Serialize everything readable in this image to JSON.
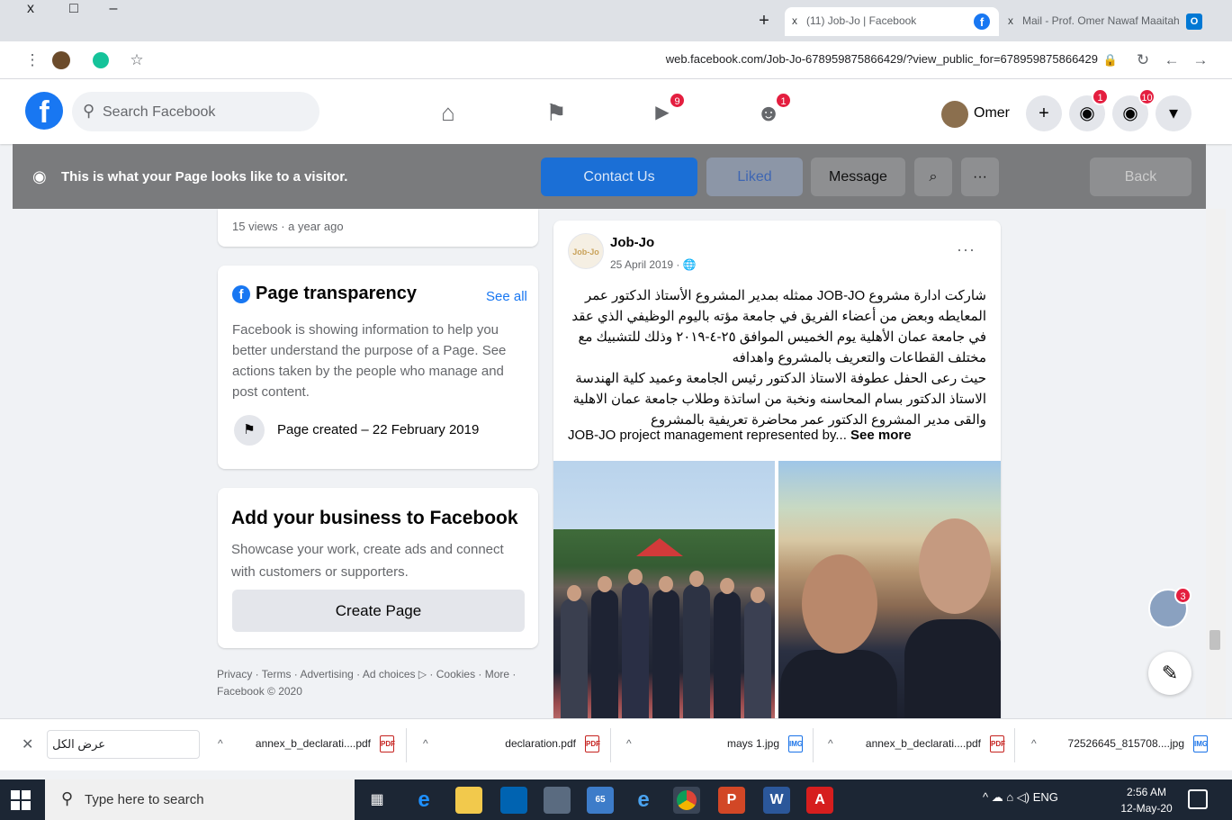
{
  "browser": {
    "window_controls": [
      "x",
      "□",
      "–"
    ],
    "new_tab": "+",
    "tabs": [
      {
        "title": "(11) Job-Jo | Facebook",
        "close": "x",
        "favicon": "f"
      },
      {
        "title": "Mail - Prof. Omer Nawaf Maaitah",
        "close": "x",
        "favicon": "O"
      }
    ],
    "url": "web.facebook.com/Job-Jo-678959875866429/?view_public_for=678959875866429",
    "nav_icons": {
      "menu": "⋮",
      "star": "☆",
      "lock": "🔒",
      "reload": "↻",
      "back": "←",
      "forward": "→"
    }
  },
  "fb_header": {
    "logo": "f",
    "search_placeholder": "Search Facebook",
    "nav": [
      {
        "name": "home-icon",
        "glyph": "⌂",
        "badge": ""
      },
      {
        "name": "flag-icon",
        "glyph": "⚑",
        "badge": ""
      },
      {
        "name": "watch-icon",
        "glyph": "▶",
        "badge": "9"
      },
      {
        "name": "groups-icon",
        "glyph": "☻",
        "badge": "1"
      }
    ],
    "profile_name": "Omer",
    "buttons": {
      "create": "+",
      "messenger_badge": "1",
      "notifications_badge": "10",
      "menu": "▾"
    }
  },
  "visitor_bar": {
    "text": "This is what your Page looks like to a visitor.",
    "contact": "Contact Us",
    "liked": "Liked",
    "message": "Message",
    "search": "⌕",
    "more": "···",
    "back": "Back"
  },
  "left": {
    "video_meta": "15 views · a year ago",
    "transparency": {
      "title": "Page transparency",
      "see_all": "See all",
      "description": "Facebook is showing information to help you better understand the purpose of a Page. See actions taken by the people who manage and post content.",
      "created": "Page created – 22 February 2019"
    },
    "business": {
      "title": "Add your business to Facebook",
      "description": "Showcase your work, create ads and connect with customers or supporters.",
      "button": "Create Page"
    },
    "footer": "Privacy · Terms · Advertising · Ad choices ▷ · Cookies · More · Facebook © 2020"
  },
  "post": {
    "avatar_text": "Job-Jo",
    "author": "Job-Jo",
    "date": "25 April 2019 · 🌐",
    "more": "···",
    "arabic": "شاركت ادارة مشروع JOB-JO ممثله بمدير المشروع الأستاذ الدكتور عمر المعايطه وبعض من أعضاء الفريق في جامعة مؤته باليوم الوظيفي الذي عقد في جامعة عمان الأهلية يوم الخميس الموافق ٢٥-٤-٢٠١٩ وذلك للتشبيك مع مختلف القطاعات والتعريف بالمشروع واهدافه\nحيث رعى الحفل عطوفة الاستاذ الدكتور رئيس الجامعة وعميد كلية الهندسة الاستاذ الدكتور بسام المحاسنه ونخبة من اساتذة وطلاب جامعة عمان الاهلية\nوالقى مدير المشروع الدكتور عمر محاضرة تعريفية بالمشروع",
    "english": "JOB-JO project management represented by...",
    "see_more": "See more"
  },
  "floating": {
    "chat_badge": "3",
    "compose": "✎"
  },
  "downloads": {
    "close": "✕",
    "show_all": "عرض الكل",
    "items": [
      {
        "name": "annex_b_declarati....pdf",
        "type": "PDF"
      },
      {
        "name": "declaration.pdf",
        "type": "PDF"
      },
      {
        "name": "mays 1.jpg",
        "type": "IMG"
      },
      {
        "name": "annex_b_declarati....pdf",
        "type": "PDF"
      },
      {
        "name": "72526645_815708....jpg",
        "type": "IMG"
      }
    ]
  },
  "taskbar": {
    "search": "Type here to search",
    "tray": "^ ☁ ⌂ ◁) ENG",
    "time": "2:56 AM",
    "date": "12-May-20"
  },
  "colors": {
    "facebook_blue": "#1877f2",
    "badge_red": "#e41e3f",
    "visitor_bar": "#7a7b7d"
  }
}
